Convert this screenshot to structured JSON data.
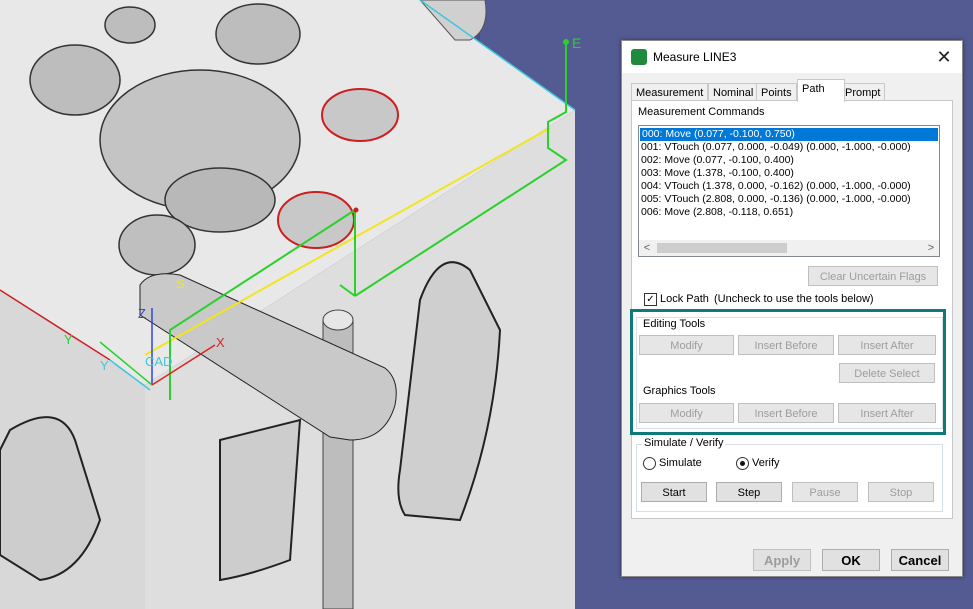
{
  "viewport": {
    "labels": {
      "e": "E",
      "s": "S",
      "z": "Z",
      "y1": "Y",
      "y2": "Y",
      "x": "X",
      "cad": "CAD"
    },
    "colors": {
      "background": "#4a4f86",
      "part": "#e3e3e3",
      "path": "#2ad12a",
      "edge_yellow": "#f2e51d"
    }
  },
  "dialog": {
    "title": "Measure LINE3",
    "close": "✕",
    "tabs": [
      "Measurement",
      "Nominal",
      "Points",
      "Path",
      "Prompt"
    ],
    "active_tab": "Path",
    "measurement_commands_label": "Measurement Commands",
    "commands": [
      "000: Move (0.077, -0.100, 0.750)",
      "001: VTouch (0.077, 0.000, -0.049) (0.000, -1.000, -0.000)",
      "002: Move (0.077, -0.100, 0.400)",
      "003: Move (1.378, -0.100, 0.400)",
      "004: VTouch (1.378, 0.000, -0.162) (0.000, -1.000, -0.000)",
      "005: VTouch (2.808, 0.000, -0.136) (0.000, -1.000, -0.000)",
      "006: Move (2.808, -0.118, 0.651)"
    ],
    "selected_command": 0,
    "scroll_left": "<",
    "scroll_right": ">",
    "clear_uncertain_flags": "Clear Uncertain Flags",
    "lock_path_label": "Lock Path",
    "lock_path_hint": "(Uncheck to use the tools below)",
    "lock_path_checked": true,
    "check_mark": "✓",
    "editing_tools_label": "Editing Tools",
    "editing_tools": {
      "modify": "Modify",
      "insert_before": "Insert Before",
      "insert_after": "Insert After",
      "delete_select": "Delete Select"
    },
    "graphics_tools_label": "Graphics Tools",
    "graphics_tools": {
      "modify": "Modify",
      "insert_before": "Insert Before",
      "insert_after": "Insert After"
    },
    "simulate_verify_label": "Simulate / Verify",
    "simulate_label": "Simulate",
    "verify_label": "Verify",
    "verify_selected": true,
    "sim_buttons": {
      "start": "Start",
      "step": "Step",
      "pause": "Pause",
      "stop": "Stop"
    },
    "footer": {
      "apply": "Apply",
      "ok": "OK",
      "cancel": "Cancel"
    },
    "colors": {
      "highlight": "#0e7a7a",
      "selection": "#0078d7"
    }
  }
}
